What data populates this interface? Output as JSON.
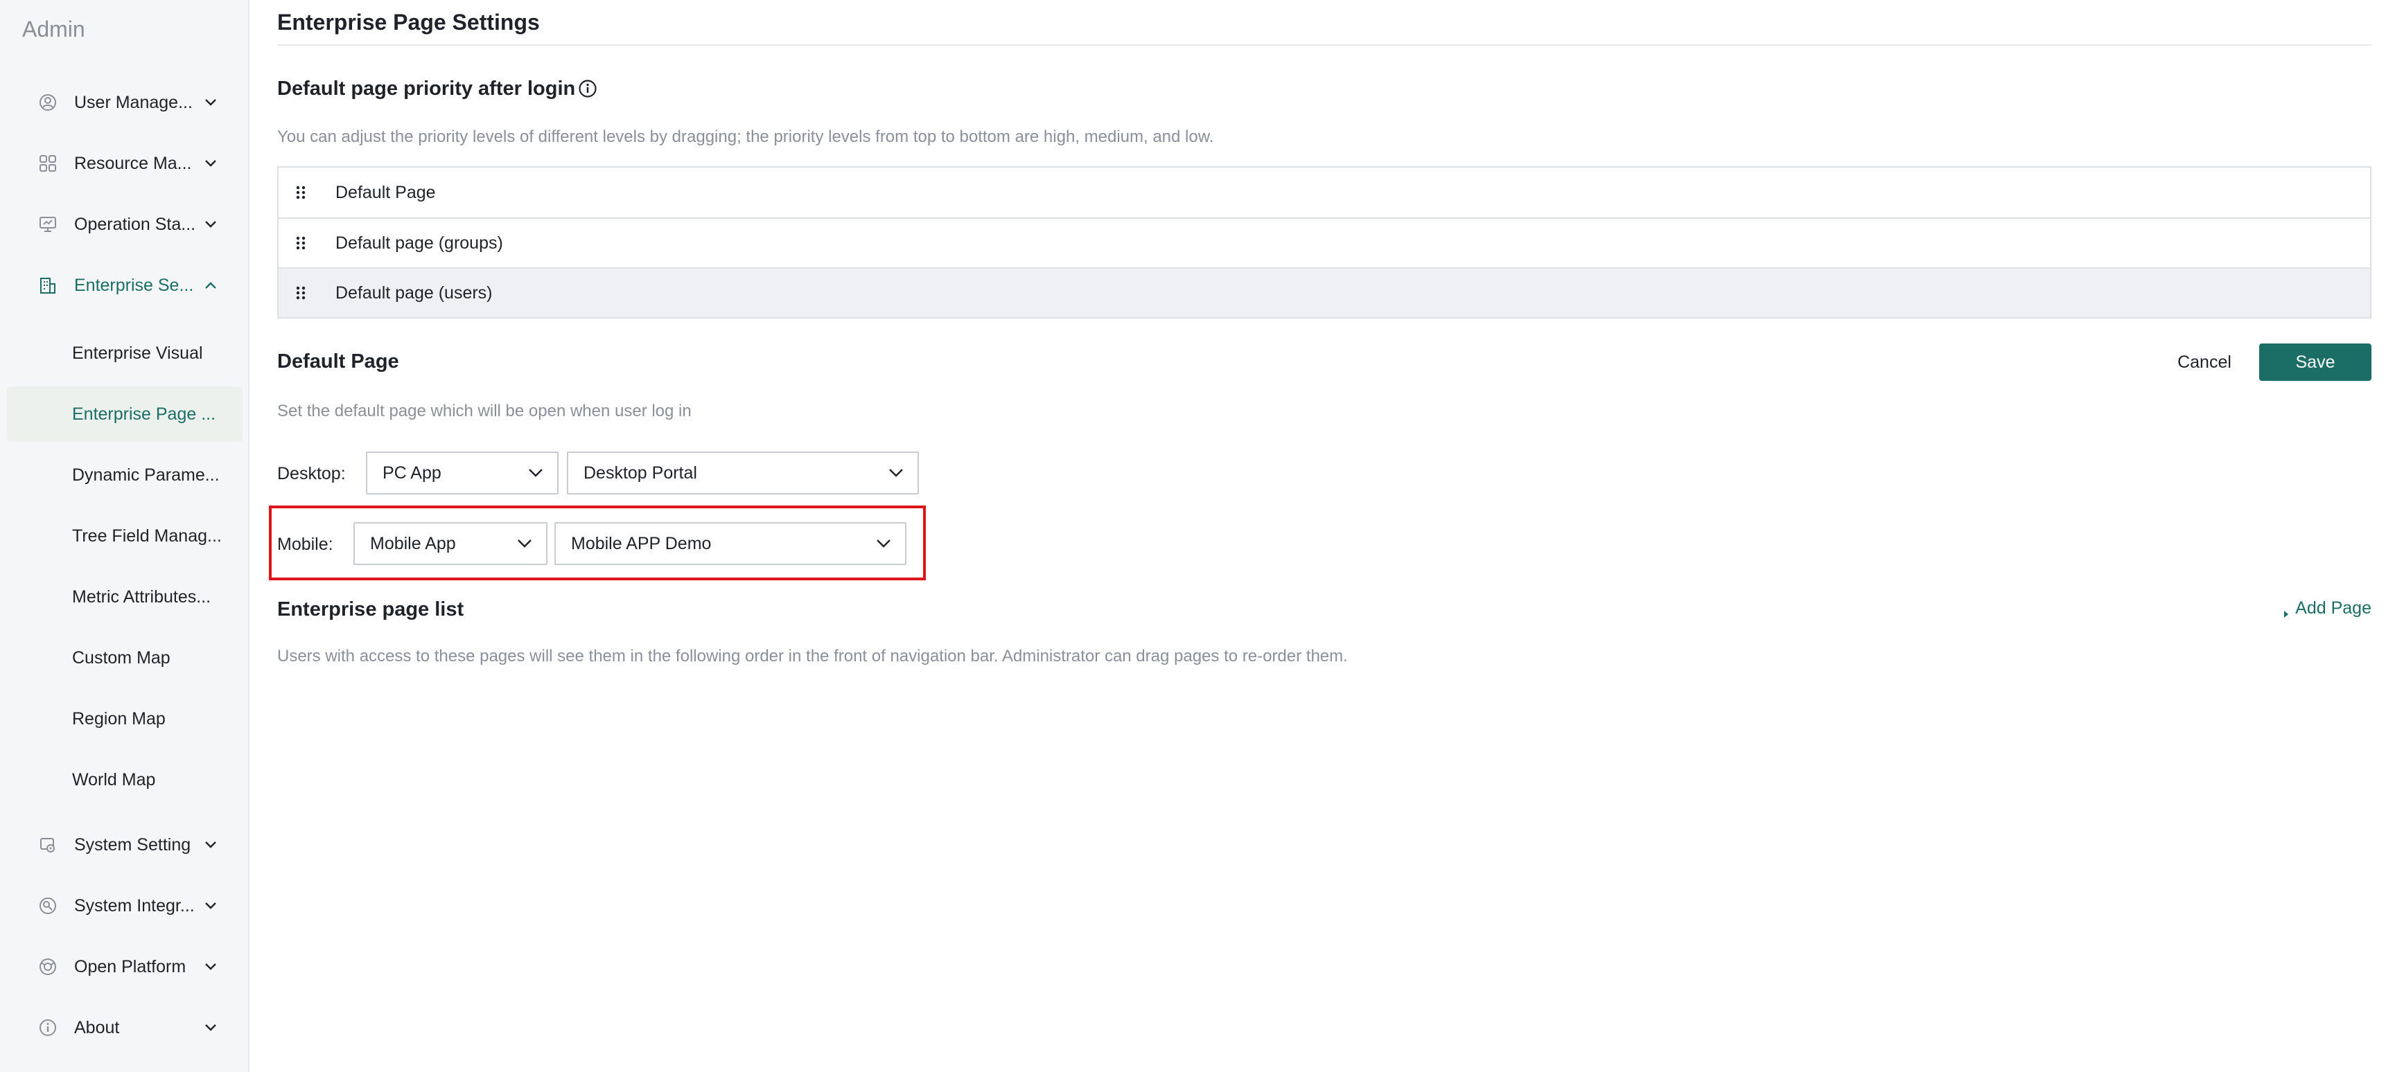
{
  "sidebar": {
    "brand": "Admin",
    "items": [
      {
        "label": "User Manage...",
        "icon": "user-icon"
      },
      {
        "label": "Resource Ma...",
        "icon": "grid-icon"
      },
      {
        "label": "Operation Sta...",
        "icon": "monitor-icon"
      },
      {
        "label": "Enterprise Se...",
        "icon": "building-icon",
        "expanded": true
      },
      {
        "label": "System Setting",
        "icon": "settings-icon"
      },
      {
        "label": "System Integr...",
        "icon": "integration-icon"
      },
      {
        "label": "Open Platform",
        "icon": "platform-icon"
      },
      {
        "label": "About",
        "icon": "info-icon"
      }
    ],
    "sub_items": [
      {
        "label": "Enterprise Visual"
      },
      {
        "label": "Enterprise Page ..."
      },
      {
        "label": "Dynamic Parame..."
      },
      {
        "label": "Tree Field Manag..."
      },
      {
        "label": "Metric Attributes..."
      },
      {
        "label": "Custom Map"
      },
      {
        "label": "Region Map"
      },
      {
        "label": "World Map"
      }
    ],
    "selected_sub_item": "Enterprise Page ..."
  },
  "main": {
    "title": "Enterprise Page Settings",
    "priority": {
      "title": "Default page priority after login",
      "description": "You can adjust the priority levels of different levels by dragging; the priority levels from top to bottom are high, medium, and low.",
      "rows": [
        {
          "label": "Default Page"
        },
        {
          "label": "Default page (groups)"
        },
        {
          "label": "Default page (users)"
        }
      ]
    },
    "default_page": {
      "title": "Default Page",
      "description": "Set the default page which will be open when user log in",
      "cancel_label": "Cancel",
      "save_label": "Save",
      "desktop": {
        "label": "Desktop:",
        "app": "PC App",
        "page": "Desktop Portal"
      },
      "mobile": {
        "label": "Mobile:",
        "app": "Mobile App",
        "page": "Mobile APP Demo"
      }
    },
    "page_list": {
      "title": "Enterprise page list",
      "add_label": "Add Page",
      "description": "Users with access to these pages will see them in the following order in the front of navigation bar. Administrator can drag pages to re-order them."
    }
  },
  "colors": {
    "accent": "#1a6e66",
    "highlight_border": "#e0151b",
    "sidebar_bg": "#f5f6f7"
  }
}
